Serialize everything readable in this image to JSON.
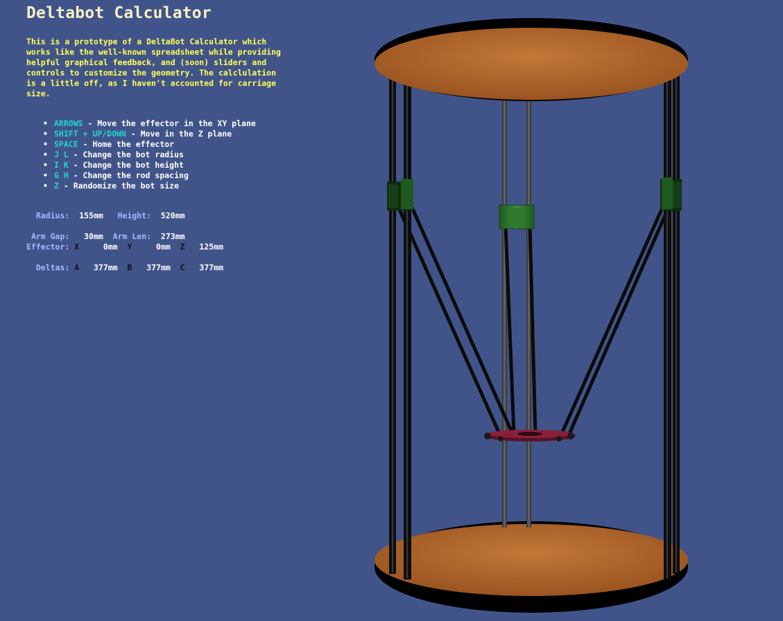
{
  "title": "Deltabot Calculator",
  "intro": "This is a prototype of a DeltaBot Calculator which works like the well-known spreadsheet while providing helpful graphical feedback, and (soon) sliders and controls to customize the geometry. The calclulation is a little off, as I haven't accounted for carriage size.",
  "controls": [
    {
      "key": "ARROWS",
      "desc": " - Move the effector in the XY plane"
    },
    {
      "key": "SHIFT + UP/DOWN",
      "desc": " - Move in the Z plane"
    },
    {
      "key": "SPACE",
      "desc": " - Home the effector"
    },
    {
      "key": "J L",
      "desc": " - Change the bot radius"
    },
    {
      "key": "I K",
      "desc": " - Change the bot height"
    },
    {
      "key": "G H",
      "desc": " - Change the rod spacing"
    },
    {
      "key": "Z",
      "desc": " - Randomize the bot size"
    }
  ],
  "geometry": {
    "radius_label": "Radius:",
    "radius_value": "155mm",
    "height_label": "Height:",
    "height_value": "520mm",
    "arm_gap_label": "Arm Gap:",
    "arm_gap_value": "30mm",
    "arm_len_label": "Arm Len:",
    "arm_len_value": "273mm"
  },
  "effector": {
    "label": "Effector:",
    "x_label": "X",
    "x_value": "0mm",
    "y_label": "Y",
    "y_value": "0mm",
    "z_label": "Z",
    "z_value": "125mm"
  },
  "deltas": {
    "label": "Deltas:",
    "a_label": "A",
    "a_value": "377mm",
    "b_label": "B",
    "b_value": "377mm",
    "c_label": "C",
    "c_value": "377mm"
  },
  "colors": {
    "background": "#41548a",
    "title": "#f7f2c4",
    "intro_text": "#ffff55",
    "key_highlight": "#22d3d3",
    "stat_label": "#a9b6ff",
    "platform": "#b86a2c",
    "carriage": "#2f7a2f",
    "effector": "#8a1f3a"
  }
}
